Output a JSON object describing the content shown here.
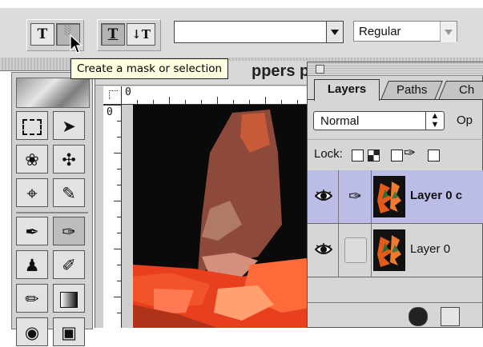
{
  "options_bar": {
    "type_tool_label": "T",
    "mask_tool_label": "░",
    "orient_horizontal_label": "T",
    "orient_vertical_label": "↓T",
    "font_family_value": "",
    "font_style_value": "Regular"
  },
  "tooltip": {
    "text": "Create a mask or selection"
  },
  "document": {
    "title_fragment": "ppers p",
    "ruler_h_zero": "0",
    "ruler_v_zero": "0"
  },
  "layers_palette": {
    "tabs": [
      "Layers",
      "Paths",
      "Ch"
    ],
    "blend_mode": "Normal",
    "opacity_label": "Op",
    "lock_label": "Lock:",
    "layers": [
      {
        "name": "Layer 0 c",
        "selected": true
      },
      {
        "name": "Layer 0",
        "selected": false
      }
    ]
  },
  "colors": {
    "selection_highlight": "#bcbde6",
    "tooltip_bg": "#ffffe1",
    "chrome": "#d6d6d6"
  },
  "icons": [
    "type-icon",
    "type-mask-icon",
    "horizontal-type-icon",
    "vertical-type-icon",
    "marquee-icon",
    "move-icon",
    "lasso-icon",
    "magic-wand-icon",
    "crop-icon",
    "slice-icon",
    "healing-brush-icon",
    "brush-icon",
    "stamp-icon",
    "history-brush-icon",
    "eraser-icon",
    "gradient-icon",
    "blur-icon",
    "sponge-icon",
    "eye-icon",
    "brush-link-icon",
    "lock-transparency-icon",
    "lock-image-icon",
    "lock-position-icon",
    "lock-all-icon"
  ]
}
